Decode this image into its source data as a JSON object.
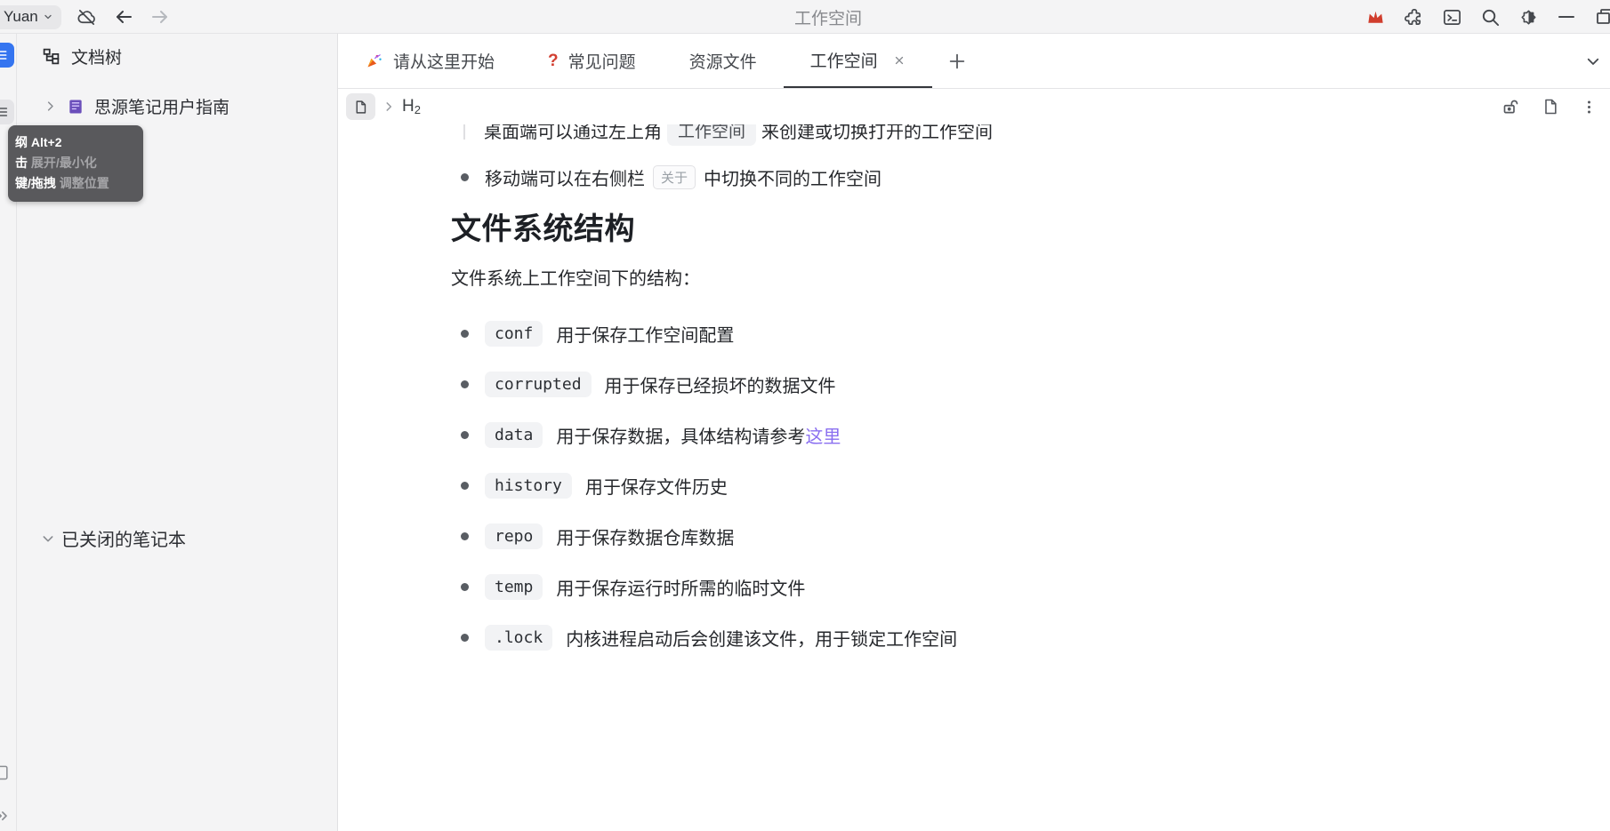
{
  "titlebar": {
    "workspace_button_label": "Yuan",
    "window_title": "工作空间"
  },
  "tabs": [
    {
      "label": "请从这里开始",
      "icon": "party-popper"
    },
    {
      "label": "常见问题",
      "icon": "question-mark",
      "icon_glyph": "?"
    },
    {
      "label": "资源文件"
    },
    {
      "label": "工作空间",
      "active": true,
      "closable": true
    }
  ],
  "breadcrumb": {
    "heading": "H",
    "heading_sub": "2"
  },
  "sidebar": {
    "panel_title": "文档树",
    "tree_items": [
      {
        "label": "思源笔记用户指南"
      }
    ],
    "closed_notebooks_label": "已关闭的笔记本",
    "tooltip": {
      "line1_strong": "纲 Alt+2",
      "line2_strong": "击",
      "line2_muted": "展开/最小化",
      "line3_strong": "键/拖拽",
      "line3_muted": "调整位置"
    }
  },
  "content": {
    "clipped_line": {
      "note": "partially scrolled out of view",
      "before": "桌面端可以通过左上角",
      "pill": "工作空间",
      "after": "来创建或切换打开的工作空间"
    },
    "bullet_about": {
      "before": "移动端可以在右侧栏",
      "kbd": "关于",
      "after": "中切换不同的工作空间"
    },
    "heading": "文件系统结构",
    "paragraph": "文件系统上工作空间下的结构：",
    "fs_items": [
      {
        "code": "conf",
        "desc": "用于保存工作空间配置"
      },
      {
        "code": "corrupted",
        "desc": "用于保存已经损坏的数据文件"
      },
      {
        "code": "data",
        "desc": "用于保存数据，具体结构请参考",
        "link": "这里"
      },
      {
        "code": "history",
        "desc": "用于保存文件历史"
      },
      {
        "code": "repo",
        "desc": "用于保存数据仓库数据"
      },
      {
        "code": "temp",
        "desc": "用于保存运行时所需的临时文件"
      },
      {
        "code": ".lock",
        "desc": "内核进程启动后会创建该文件，用于锁定工作空间"
      }
    ]
  },
  "colors": {
    "accent_blue": "#3575f0",
    "crown_red": "#d03d2d",
    "link_purple": "#8a6ff0",
    "tooltip_bg": "#59595c",
    "bar_bg": "#f4f4f5",
    "pill_bg": "#f2f3f5"
  }
}
